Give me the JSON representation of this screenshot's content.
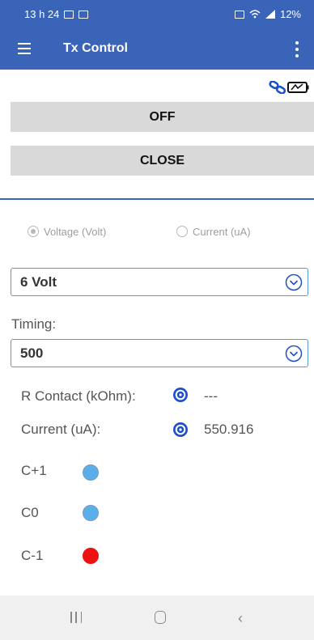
{
  "status_bar": {
    "time": "13 h 24",
    "battery": "12%"
  },
  "app_bar": {
    "title": "Tx Control"
  },
  "buttons": {
    "off": "OFF",
    "close": "CLOSE"
  },
  "mode": {
    "voltage_label": "Voltage (Volt)",
    "current_label": "Current (uA)",
    "selected": "voltage"
  },
  "voltage_select": {
    "value": "6 Volt"
  },
  "timing": {
    "label": "Timing:",
    "value": "500"
  },
  "measurements": {
    "r_contact_label": "R Contact (kOhm):",
    "r_contact_value": "---",
    "current_label": "Current (uA):",
    "current_value": "550.916"
  },
  "electrodes": [
    {
      "label": "C+1",
      "color": "#5aafea"
    },
    {
      "label": "C0",
      "color": "#5aafea"
    },
    {
      "label": "C-1",
      "color": "#ee1111"
    }
  ],
  "colors": {
    "primary": "#3a64b8",
    "accent_blue": "#1565c0",
    "select_border": "#5b9bd5"
  }
}
